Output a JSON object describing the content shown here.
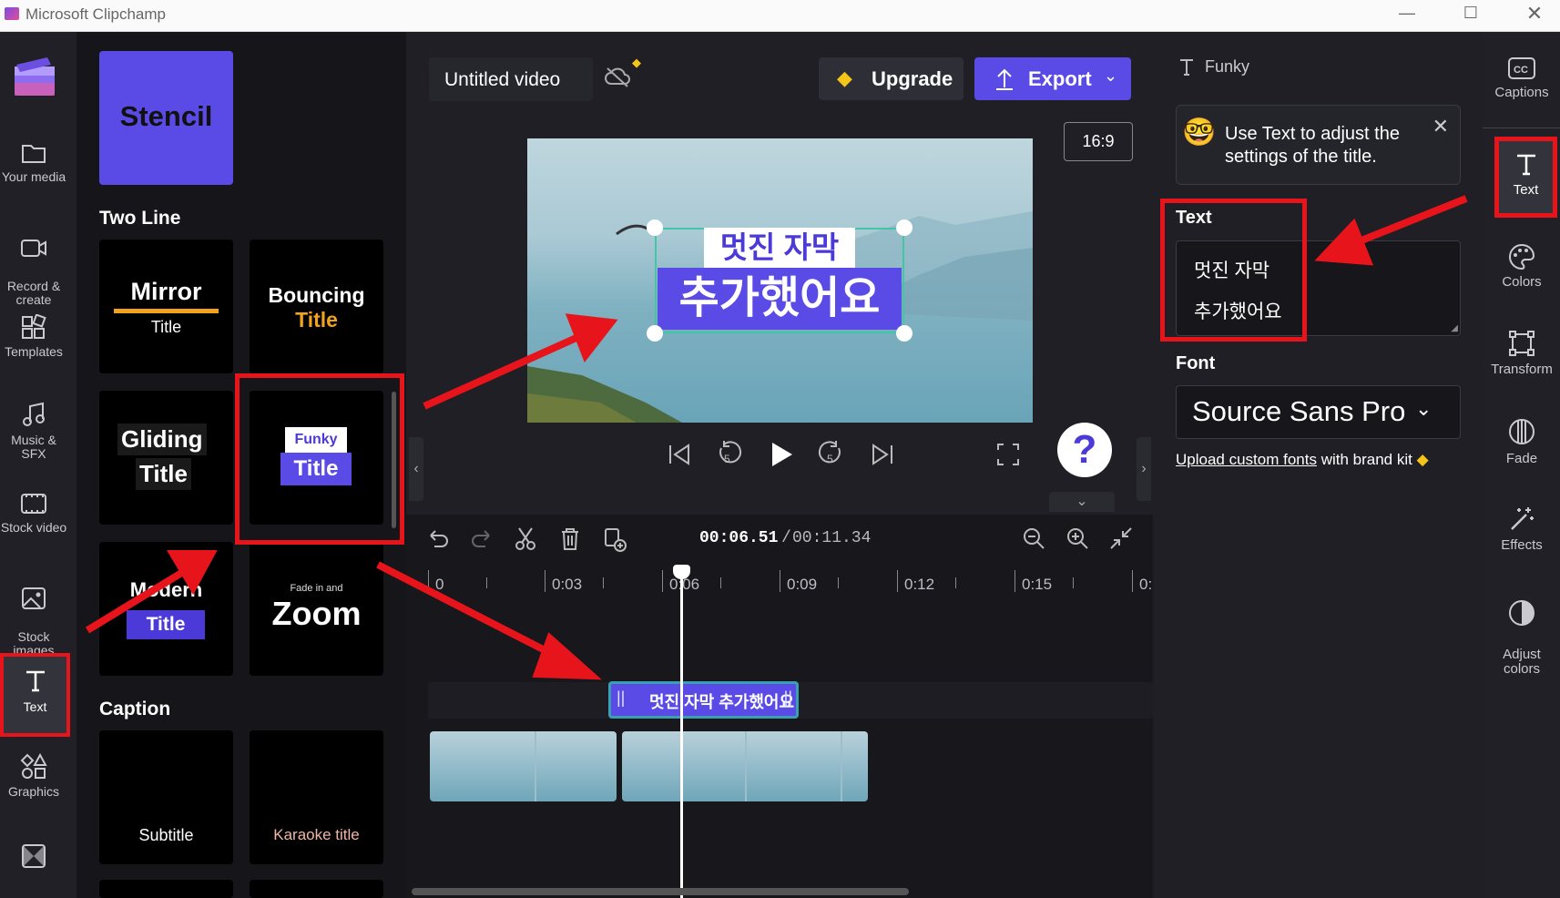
{
  "window": {
    "title": "Microsoft Clipchamp"
  },
  "left_nav": [
    {
      "label": "Your media",
      "icon": "folder-icon"
    },
    {
      "label": "Record &\ncreate",
      "icon": "camera-icon"
    },
    {
      "label": "Templates",
      "icon": "templates-icon"
    },
    {
      "label": "Music & SFX",
      "icon": "music-icon"
    },
    {
      "label": "Stock video",
      "icon": "film-icon"
    },
    {
      "label": "Stock\nimages",
      "icon": "image-icon"
    },
    {
      "label": "Text",
      "icon": "text-icon"
    },
    {
      "label": "Graphics",
      "icon": "shapes-icon"
    },
    {
      "label": "",
      "icon": "transitions-icon"
    }
  ],
  "text_panel": {
    "stencil": "Stencil",
    "section_two_line": "Two Line",
    "cards": {
      "mirror_top": "Mirror",
      "mirror_bottom": "Title",
      "bouncing_top": "Bouncing",
      "bouncing_bottom": "Title",
      "gliding_top": "Gliding",
      "gliding_bottom": "Title",
      "funky_top": "Funky",
      "funky_bottom": "Title",
      "modern_top": "Modern",
      "modern_bottom": "Title",
      "zoom_small": "Fade in and",
      "zoom_big": "Zoom"
    },
    "section_caption": "Caption",
    "caption_cards": {
      "subtitle": "Subtitle",
      "karaoke": "Karaoke title"
    }
  },
  "header": {
    "project_title": "Untitled video",
    "upgrade_label": "Upgrade",
    "export_label": "Export",
    "aspect_ratio": "16:9"
  },
  "preview": {
    "line1": "멋진 자막",
    "line2": "추가했어요",
    "help": "?"
  },
  "timeline": {
    "current_time": "00:06.51",
    "separator": "/",
    "total_time": "00:11.34",
    "ruler_labels": [
      "0",
      "0:03",
      "0:06",
      "0:09",
      "0:12",
      "0:15",
      "0:"
    ],
    "text_clip_label": "멋진 자막 추가했어요"
  },
  "properties": {
    "panel_title": "Funky",
    "tip_text": "Use Text to adjust the settings of the title.",
    "text_label": "Text",
    "text_line1": "멋진 자막",
    "text_line2": "추가했어요",
    "font_label": "Font",
    "font_value": "Source Sans Pro",
    "upload_link": "Upload custom fonts",
    "upload_suffix": " with brand kit"
  },
  "right_nav": [
    {
      "label": "Captions",
      "icon": "captions-icon"
    },
    {
      "label": "Text",
      "icon": "text-icon"
    },
    {
      "label": "Colors",
      "icon": "palette-icon"
    },
    {
      "label": "Transform",
      "icon": "transform-icon"
    },
    {
      "label": "Fade",
      "icon": "fade-icon"
    },
    {
      "label": "Effects",
      "icon": "wand-icon"
    },
    {
      "label": "Adjust\ncolors",
      "icon": "contrast-icon"
    }
  ],
  "colors": {
    "accent": "#5b4be6",
    "annotation_red": "#e8141b",
    "clip_teal": "#3a9fb0"
  }
}
